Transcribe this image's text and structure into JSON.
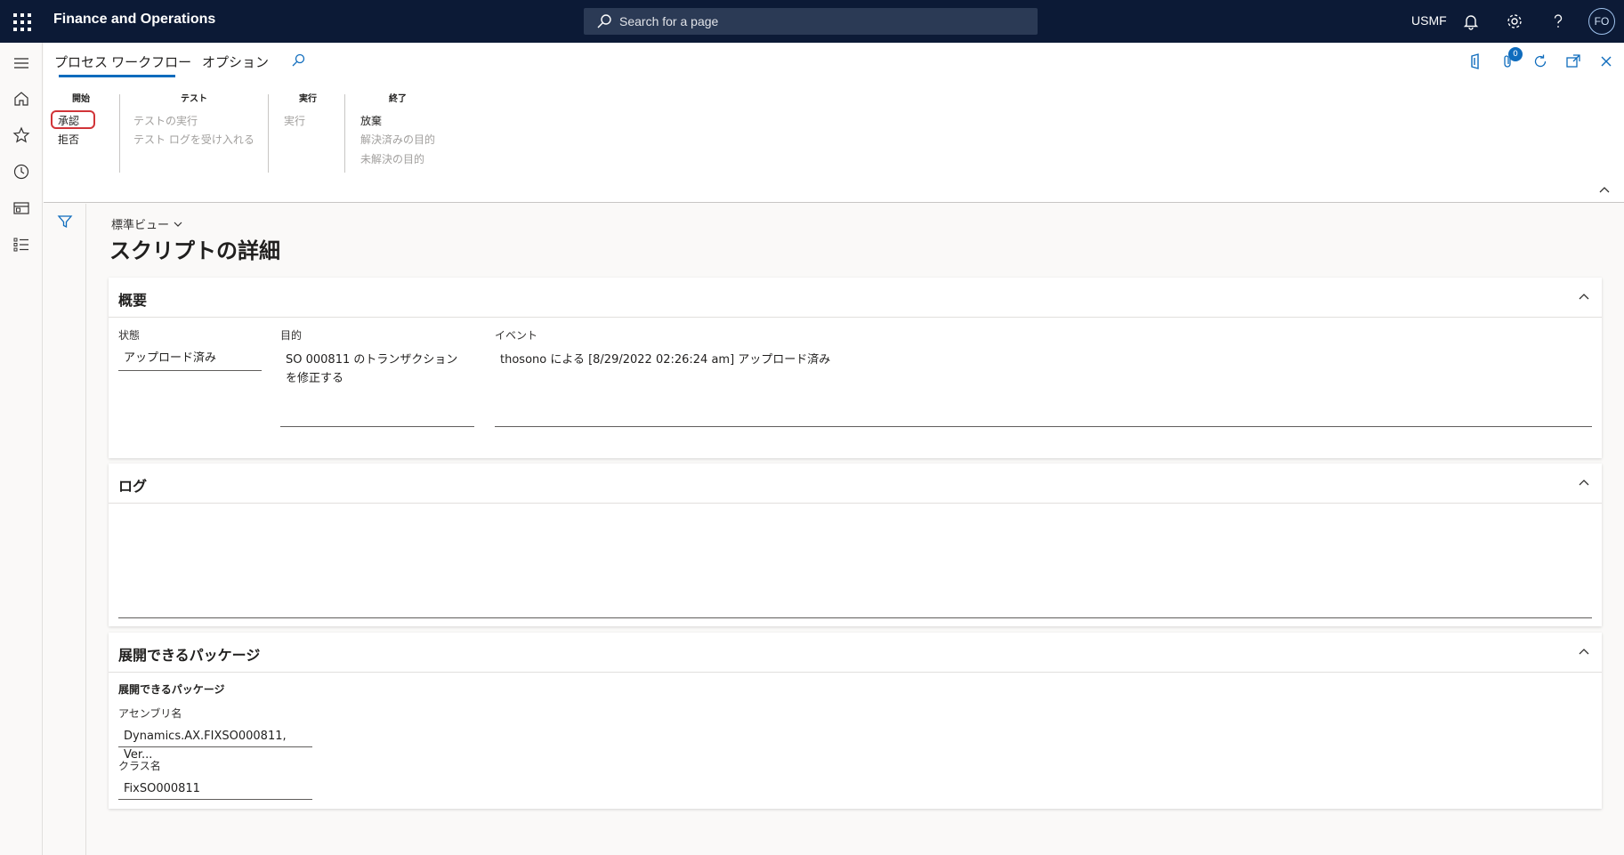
{
  "app": {
    "title": "Finance and Operations",
    "search_placeholder": "Search for a page",
    "company": "USMF",
    "user_initials": "FO"
  },
  "actionpane": {
    "tabs": [
      "プロセス ワークフロー",
      "オプション"
    ],
    "groups": [
      {
        "title": "開始",
        "actions": [
          {
            "label": "承認",
            "enabled": true,
            "highlighted": true
          },
          {
            "label": "拒否",
            "enabled": true
          }
        ]
      },
      {
        "title": "テスト",
        "actions": [
          {
            "label": "テストの実行",
            "enabled": false
          },
          {
            "label": "テスト ログを受け入れる",
            "enabled": false
          }
        ]
      },
      {
        "title": "実行",
        "actions": [
          {
            "label": "実行",
            "enabled": false
          }
        ]
      },
      {
        "title": "終了",
        "actions": [
          {
            "label": "放棄",
            "enabled": true
          },
          {
            "label": "解決済みの目的",
            "enabled": false
          },
          {
            "label": "未解決の目的",
            "enabled": false
          }
        ]
      }
    ],
    "attachments_count": "0"
  },
  "page": {
    "view": "標準ビュー",
    "title": "スクリプトの詳細"
  },
  "overview": {
    "title": "概要",
    "status_label": "状態",
    "status_value": "アップロード済み",
    "purpose_label": "目的",
    "purpose_value": "SO 000811 のトランザクション\nを修正する",
    "event_label": "イベント",
    "event_value": "thosono による [8/29/2022 02:26:24 am] アップロード済み"
  },
  "log": {
    "title": "ログ"
  },
  "packages": {
    "title": "展開できるパッケージ",
    "subtitle": "展開できるパッケージ",
    "assembly_label": "アセンブリ名",
    "assembly_value": "Dynamics.AX.FIXSO000811, Ver...",
    "class_label": "クラス名",
    "class_value": "FixSO000811"
  },
  "colors": {
    "topbar": "#0c1a36",
    "accent": "#0f6cbd",
    "highlight": "#d13438"
  }
}
